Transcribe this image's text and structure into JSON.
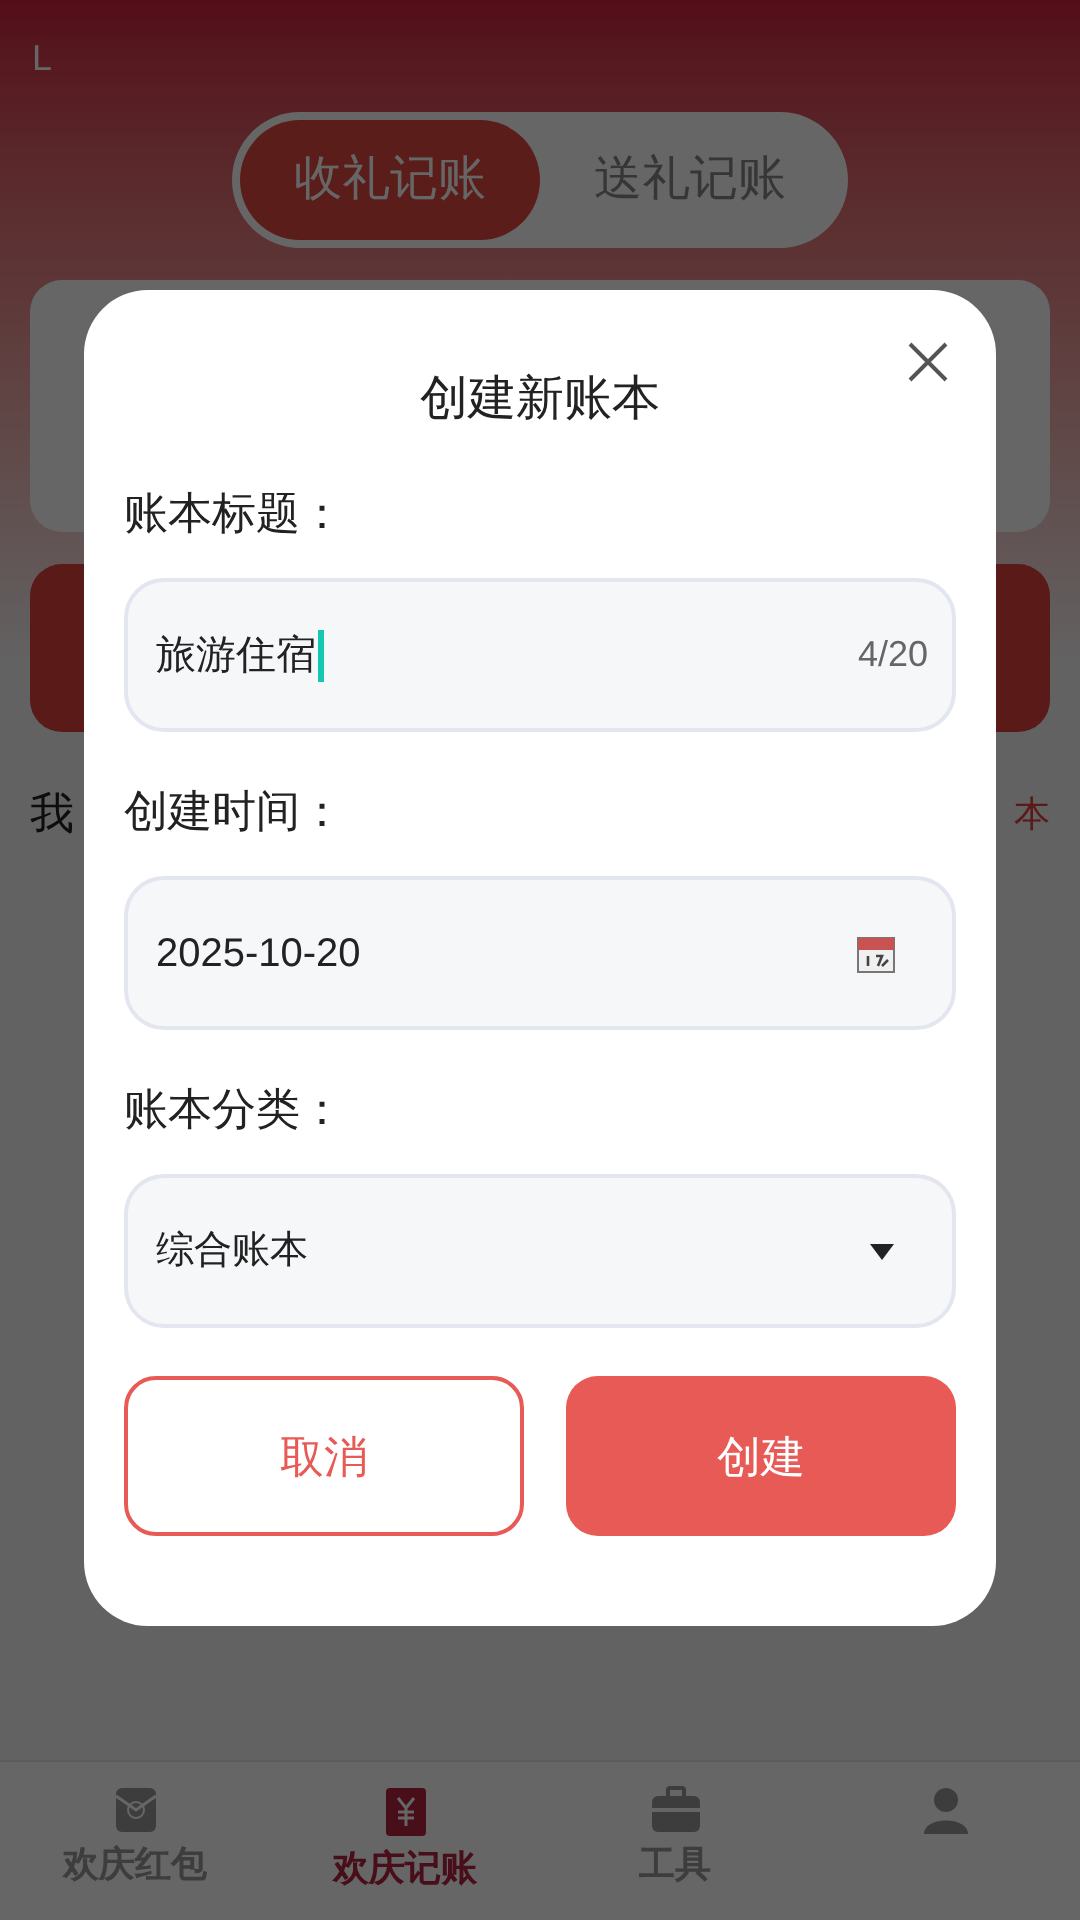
{
  "status_bar": {
    "text": "L"
  },
  "segments": [
    {
      "label": "收礼记账",
      "selected": true
    },
    {
      "label": "送礼记账",
      "selected": false
    }
  ],
  "list_header": {
    "title_fragment": "我",
    "link_fragment": "本"
  },
  "bottom_nav": [
    {
      "label": "欢庆红包",
      "selected": false
    },
    {
      "label": "欢庆记账",
      "selected": true
    },
    {
      "label": "工具",
      "selected": false
    },
    {
      "selected": false
    }
  ],
  "dialog": {
    "title": "创建新账本",
    "fields": [
      {
        "kind": "text",
        "label": "账本标题：",
        "value": "旅游住宿",
        "counter": "4/20",
        "focused": true
      },
      {
        "kind": "date",
        "label": "创建时间：",
        "value": "2025-10-20",
        "focused": false
      },
      {
        "kind": "select",
        "label": "账本分类：",
        "value": "综合账本",
        "focused": false
      }
    ],
    "buttons": [
      {
        "label": "取消",
        "kind": "secondary"
      },
      {
        "label": "创建",
        "kind": "primary"
      }
    ]
  }
}
